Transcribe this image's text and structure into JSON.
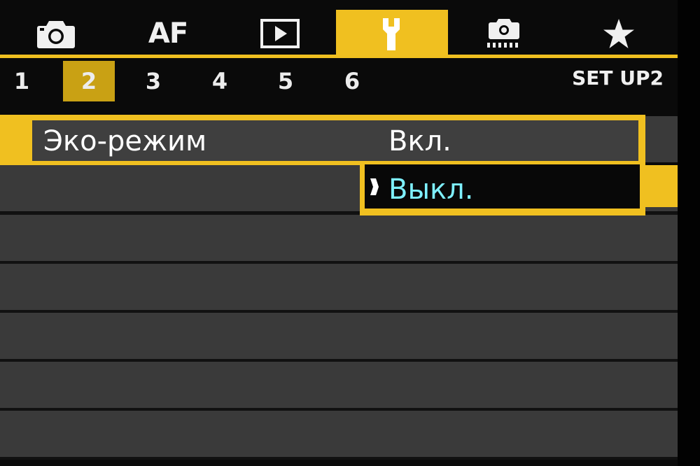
{
  "colors": {
    "accent": "#f0c020",
    "sub_active": "#c9a114",
    "selected_value": "#7ef0ff",
    "row_bg": "#3a3a3a",
    "background": "#0a0a0a"
  },
  "tabs": [
    {
      "id": "shooting",
      "icon": "camera-icon",
      "label": ""
    },
    {
      "id": "af",
      "icon": "",
      "label": "AF"
    },
    {
      "id": "playback",
      "icon": "playback-icon",
      "label": ""
    },
    {
      "id": "setup",
      "icon": "wrench-icon",
      "label": "",
      "active": true
    },
    {
      "id": "custom",
      "icon": "custom-functions-icon",
      "label": ""
    },
    {
      "id": "mymenu",
      "icon": "star-icon",
      "label": ""
    }
  ],
  "subtabs": [
    "1",
    "2",
    "3",
    "4",
    "5",
    "6"
  ],
  "active_subtab": "2",
  "page_name": "SET UP2",
  "menu": {
    "item_label": "Эко-режим",
    "options": [
      "Вкл.",
      "Выкл."
    ],
    "selected_option": "Выкл."
  }
}
